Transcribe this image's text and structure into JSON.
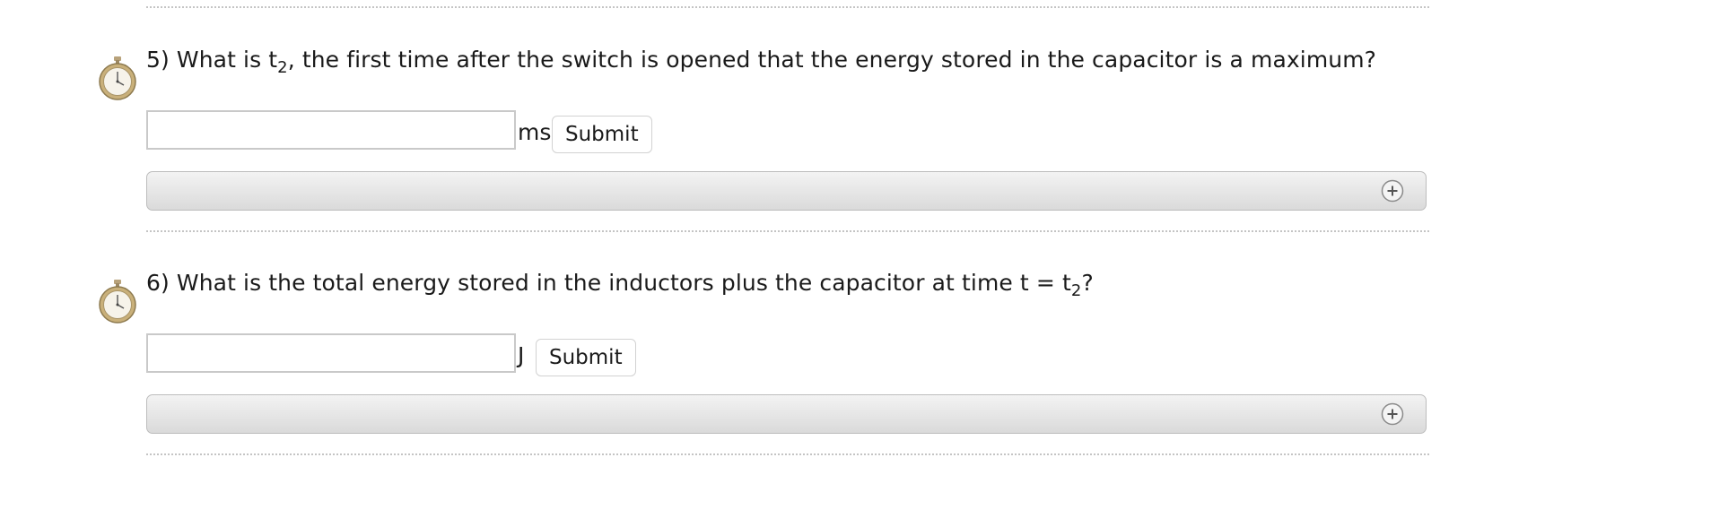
{
  "questions": [
    {
      "number": "5)",
      "text_before_sub": "What is t",
      "subscript": "2",
      "text_after_sub": ", the first time after the switch is opened that the energy stored in the capacitor is a maximum?",
      "input_value": "",
      "unit": "ms",
      "submit_label": "Submit",
      "timer_icon": "stopwatch-icon",
      "expand_icon": "plus-circle-icon"
    },
    {
      "number": "6)",
      "text_before_sub": "What is the total energy stored in the inductors plus the capacitor at time t = t",
      "subscript": "2",
      "text_after_sub": "?",
      "input_value": "",
      "unit": "J",
      "submit_label": "Submit",
      "timer_icon": "stopwatch-icon",
      "expand_icon": "plus-circle-icon"
    }
  ]
}
